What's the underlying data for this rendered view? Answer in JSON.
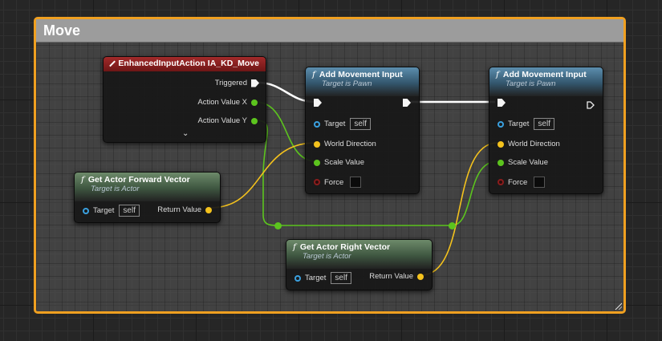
{
  "comment": {
    "title": "Move"
  },
  "event_node": {
    "title": "EnhancedInputAction IA_KD_Move",
    "pins": {
      "triggered": "Triggered",
      "action_x": "Action Value X",
      "action_y": "Action Value Y"
    },
    "expand_glyph": "⌄"
  },
  "add_movement_1": {
    "title": "Add Movement Input",
    "subtitle": "Target is Pawn",
    "pins": {
      "target": "Target",
      "target_value": "self",
      "world_direction": "World Direction",
      "scale_value": "Scale Value",
      "force": "Force"
    }
  },
  "add_movement_2": {
    "title": "Add Movement Input",
    "subtitle": "Target is Pawn",
    "pins": {
      "target": "Target",
      "target_value": "self",
      "world_direction": "World Direction",
      "scale_value": "Scale Value",
      "force": "Force"
    }
  },
  "forward_vector": {
    "title": "Get Actor Forward Vector",
    "subtitle": "Target is Actor",
    "pins": {
      "target": "Target",
      "target_value": "self",
      "return_value": "Return Value"
    }
  },
  "right_vector": {
    "title": "Get Actor Right Vector",
    "subtitle": "Target is Actor",
    "pins": {
      "target": "Target",
      "target_value": "self",
      "return_value": "Return Value"
    }
  },
  "function_glyph": "f",
  "colors": {
    "comment_border": "#f0a020",
    "exec": "#ffffff",
    "float_pin": "#5cc41e",
    "vector_pin": "#f4c21d",
    "object_pin": "#3aa0df",
    "bool_pin": "#8a1c1c"
  }
}
